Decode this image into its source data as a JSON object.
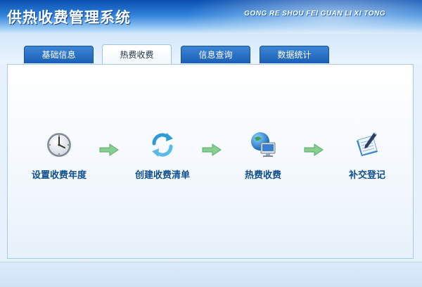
{
  "app": {
    "title": "供热收费管理系统",
    "subtitle": "GONG RE SHOU FEI GUAN LI XI TONG"
  },
  "tabs": [
    {
      "label": "基础信息",
      "active": false
    },
    {
      "label": "热费收费",
      "active": true
    },
    {
      "label": "信息查询",
      "active": false
    },
    {
      "label": "数据统计",
      "active": false
    }
  ],
  "workflow": {
    "steps": [
      {
        "label": "设置收费年度",
        "icon": "clock-icon"
      },
      {
        "label": "创建收费清单",
        "icon": "refresh-icon"
      },
      {
        "label": "热费收费",
        "icon": "computer-globe-icon"
      },
      {
        "label": "补交登记",
        "icon": "notebook-pen-icon"
      }
    ],
    "arrow_icon": "arrow-right-icon"
  },
  "colors": {
    "header_dark": "#0a4fb0",
    "tab_blue": "#1b5fb6",
    "label_blue": "#0f4f8f",
    "arrow_green": "#7ec98a"
  }
}
